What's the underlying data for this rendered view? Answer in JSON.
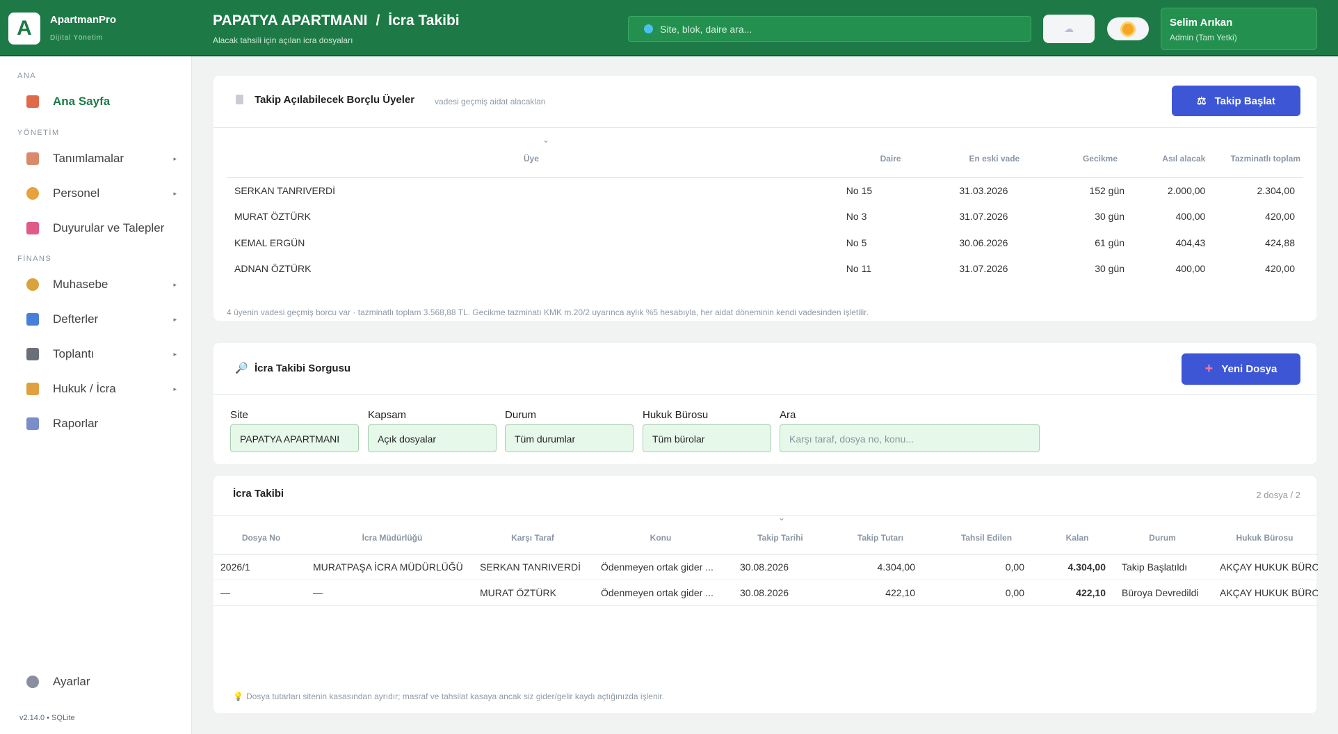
{
  "app": {
    "logo_letter": "A",
    "name": "ApartmanPro",
    "subtitle": "Dijital Yönetim"
  },
  "header": {
    "site_name": "PAPATYA APARTMANI",
    "separator": "/",
    "page_name": "İcra Takibi",
    "page_subtitle": "Alacak tahsili için açılan icra dosyaları",
    "search_placeholder": "Site, blok, daire ara...",
    "user_name": "Selim Arıkan",
    "user_role": "Admin (Tam Yetki)"
  },
  "sidebar": {
    "sections": {
      "ana": "ANA",
      "yonetim": "YÖNETİM",
      "finans": "FİNANS"
    },
    "items": [
      {
        "label": "Ana Sayfa",
        "icon": "home-icon",
        "color": "#e0694a"
      },
      {
        "label": "Tanımlamalar",
        "icon": "clipboard-icon",
        "color": "#d98a6a"
      },
      {
        "label": "Personel",
        "icon": "person-icon",
        "color": "#e6a23c"
      },
      {
        "label": "Duyurular ve Talepler",
        "icon": "megaphone-icon",
        "color": "#e05a8a"
      },
      {
        "label": "Muhasebe",
        "icon": "money-bag-icon",
        "color": "#d9a23c"
      },
      {
        "label": "Defterler",
        "icon": "bar-chart-icon",
        "color": "#4a7fd9"
      },
      {
        "label": "Toplantı",
        "icon": "clapper-icon",
        "color": "#6b6f78"
      },
      {
        "label": "Hukuk / İcra",
        "icon": "scales-icon",
        "color": "#e0a040"
      },
      {
        "label": "Raporlar",
        "icon": "line-chart-icon",
        "color": "#7a8fc9"
      },
      {
        "label": "Ayarlar",
        "icon": "gear-icon",
        "color": "#8a8fa0"
      }
    ],
    "arrow": "▸",
    "version": "v2.14.0  •  SQLite"
  },
  "debtors": {
    "title": "Takip Açılabilecek Borçlu Üyeler",
    "subtitle": "vadesi geçmiş aidat alacakları",
    "button": "Takip Başlat",
    "sort_indicator": "⌄",
    "columns": [
      "Üye",
      "Daire",
      "En eski vade",
      "Gecikme",
      "Asıl alacak",
      "Tazminatlı toplam"
    ],
    "rows": [
      {
        "member": "SERKAN TANRIVERDİ",
        "unit": "No 15",
        "due": "31.03.2026",
        "delay": "152 gün",
        "principal": "2.000,00",
        "total": "2.304,00"
      },
      {
        "member": "MURAT ÖZTÜRK",
        "unit": "No 3",
        "due": "31.07.2026",
        "delay": "30 gün",
        "principal": "400,00",
        "total": "420,00"
      },
      {
        "member": "KEMAL ERGÜN",
        "unit": "No 5",
        "due": "30.06.2026",
        "delay": "61 gün",
        "principal": "404,43",
        "total": "424,88"
      },
      {
        "member": "ADNAN ÖZTÜRK",
        "unit": "No 11",
        "due": "31.07.2026",
        "delay": "30 gün",
        "principal": "400,00",
        "total": "420,00"
      }
    ],
    "footnote": "4 üyenin vadesi geçmiş borcu var · tazminatlı toplam 3.568,88 TL. Gecikme tazminatı KMK m.20/2 uyarınca aylık %5 hesabıyla, her aidat döneminin kendi vadesinden işletilir."
  },
  "query": {
    "title": "İcra Takibi Sorgusu",
    "button": "Yeni Dosya",
    "filters": [
      {
        "label": "Site",
        "value": "PAPATYA APARTMANI"
      },
      {
        "label": "Kapsam",
        "value": "Açık dosyalar"
      },
      {
        "label": "Durum",
        "value": "Tüm durumlar"
      },
      {
        "label": "Hukuk Bürosu",
        "value": "Tüm bürolar"
      },
      {
        "label": "Ara",
        "placeholder": "Karşı taraf, dosya no, konu..."
      }
    ]
  },
  "cases": {
    "title": "İcra Takibi",
    "count": "2 dosya / 2",
    "sort_indicator": "⌄",
    "columns": [
      "Dosya No",
      "İcra Müdürlüğü",
      "Karşı Taraf",
      "Konu",
      "Takip Tarihi",
      "Takip Tutarı",
      "Tahsil Edilen",
      "Kalan",
      "Durum",
      "Hukuk Bürosu"
    ],
    "rows": [
      {
        "file_no": "2026/1",
        "office": "MURATPAŞA İCRA MÜDÜRLÜĞÜ",
        "party": "SERKAN TANRIVERDİ",
        "subject": "Ödenmeyen ortak gider ...",
        "date": "30.08.2026",
        "amount": "4.304,00",
        "collected": "0,00",
        "remaining": "4.304,00",
        "status": "Takip Başlatıldı",
        "law_office": "AKÇAY HUKUK BÜROSU"
      },
      {
        "file_no": "—",
        "office": "—",
        "party": "MURAT ÖZTÜRK",
        "subject": "Ödenmeyen ortak gider ...",
        "date": "30.08.2026",
        "amount": "422,10",
        "collected": "0,00",
        "remaining": "422,10",
        "status": "Büroya Devredildi",
        "law_office": "AKÇAY HUKUK BÜROSU"
      }
    ],
    "footnote": "Dosya tutarları sitenin kasasından ayrıdır; masraf ve tahsilat kasaya ancak siz gider/gelir kaydı açtığınızda işlenir."
  },
  "colors": {
    "brand": "#1d7a46",
    "primary": "#3d56d6",
    "warning": "#c26d14",
    "danger": "#c3282c"
  }
}
